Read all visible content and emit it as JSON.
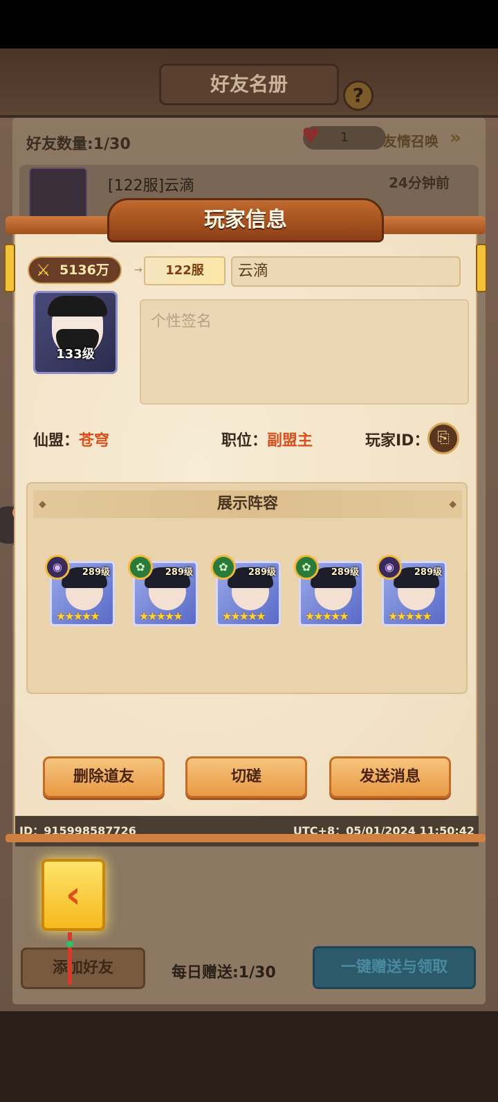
{
  "roster": {
    "title": "好友名册",
    "help_label": "?",
    "friend_count": "好友数量:1/30",
    "heart_count": "1",
    "summon_label": "友情召唤",
    "friend": {
      "name": "[122服]云滴",
      "time": "24分钟前"
    },
    "add_friend_label": "添加好友",
    "daily_gift": "每日赠送:1/30",
    "gift_all_label": "一键赠送与领取"
  },
  "modal": {
    "title": "玩家信息",
    "power": "5136万",
    "server": "122服",
    "player_name": "云滴",
    "avatar_level": "133级",
    "signature_placeholder": "个性签名",
    "guild_label": "仙盟：",
    "guild_value": "苍穹",
    "position_label": "职位：",
    "position_value": "副盟主",
    "player_id_label": "玩家ID：",
    "lineup_title": "展示阵容",
    "heroes": [
      {
        "level": "289级",
        "element": "dark-element-icon",
        "stars": "★★★★★"
      },
      {
        "level": "289级",
        "element": "wood-element-icon",
        "stars": "★★★★★"
      },
      {
        "level": "289级",
        "element": "wood-element-icon",
        "stars": "★★★★★"
      },
      {
        "level": "289级",
        "element": "wood-element-icon",
        "stars": "★★★★★"
      },
      {
        "level": "289级",
        "element": "dark-element-icon",
        "stars": "★★★★★"
      }
    ],
    "buttons": {
      "delete": "删除道友",
      "spar": "切磋",
      "message": "发送消息"
    },
    "footer_id": "ID：915998587726",
    "footer_time": "UTC+8：05/01/2024 11:50:42"
  },
  "colors": {
    "accent_orange": "#d8501c",
    "button_orange": "#e89a44",
    "ribbon": "#c06a2e",
    "back_button": "#f5b91e"
  }
}
